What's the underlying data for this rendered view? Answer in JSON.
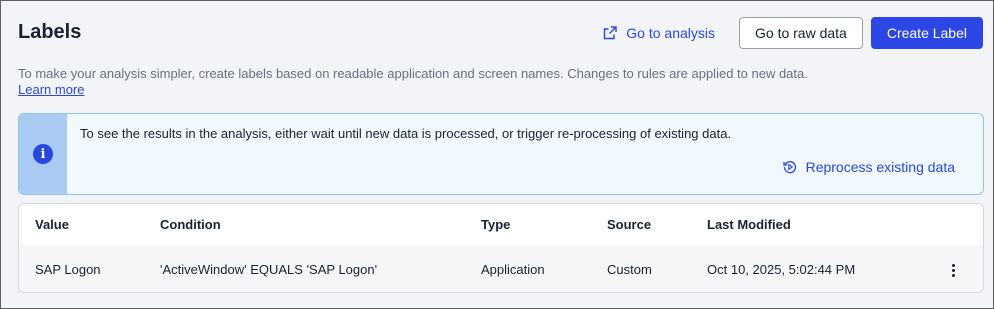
{
  "header": {
    "title": "Labels",
    "go_to_analysis_label": "Go to analysis",
    "go_to_raw_data_label": "Go to raw data",
    "create_label_label": "Create Label"
  },
  "description": {
    "text": "To make your analysis simpler, create labels based on readable application and screen names. Changes to rules are applied to new data.",
    "learn_more_label": "Learn more"
  },
  "info_banner": {
    "icon": "info-icon",
    "message": "To see the results in the analysis, either wait until new data is processed, or trigger re-processing of existing data.",
    "reprocess_label": "Reprocess existing data"
  },
  "table": {
    "columns": [
      "Value",
      "Condition",
      "Type",
      "Source",
      "Last Modified"
    ],
    "rows": [
      {
        "value": "SAP Logon",
        "condition": "'ActiveWindow' EQUALS 'SAP Logon'",
        "type": "Application",
        "source": "Custom",
        "last_modified": "Oct 10, 2025, 5:02:44 PM"
      }
    ]
  },
  "colors": {
    "accent": "#2c47e6",
    "banner_bg": "#f1f8fe",
    "banner_strip": "#a9cbf2"
  }
}
